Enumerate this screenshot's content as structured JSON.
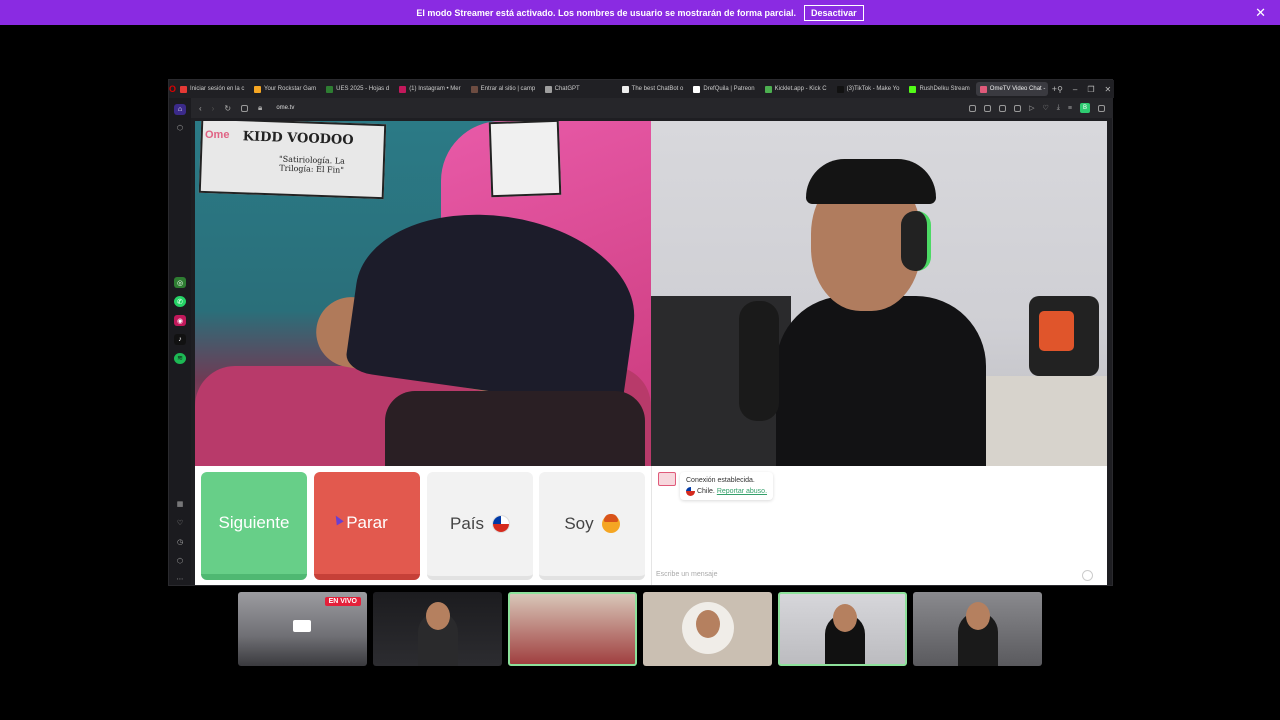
{
  "banner": {
    "message": "El modo Streamer está activado. Los nombres de usuario se mostrarán de forma parcial.",
    "button_label": "Desactivar",
    "close": "✕"
  },
  "browser": {
    "logo": "O",
    "tabs": [
      {
        "label": "Iniciar sesión en la c",
        "color": "#e53935"
      },
      {
        "label": "Your Rockstar Gam",
        "color": "#f5a623"
      },
      {
        "label": "UES 2025 - Hojas d",
        "color": "#2e7d32"
      },
      {
        "label": "(1) Instagram • Mer",
        "color": "#c2185b"
      },
      {
        "label": "Entrar al sitio | camp",
        "color": "#6d4c41"
      },
      {
        "label": "ChatGPT",
        "color": "#9e9e9e"
      },
      {
        "label": "The best ChatBot o",
        "color": "#eeeeee"
      },
      {
        "label": "DrefQuila | Patreon",
        "color": "#ffffff"
      },
      {
        "label": "Kicklet.app - Kick C",
        "color": "#4caf50"
      },
      {
        "label": "(3)TikTok - Make Yo",
        "color": "#111111"
      },
      {
        "label": "RushDelku Stream",
        "color": "#53fc18"
      },
      {
        "label": "OmeTV Video Chat -",
        "color": "#e05a7a"
      }
    ],
    "active_tab_index": 11,
    "url": "ome.tv",
    "window_controls": [
      "⚲",
      "–",
      "❐",
      "✕"
    ]
  },
  "page": {
    "watermark": "Ome",
    "poster_title": "KIDD VOODOO",
    "poster_subtitle": "\"Satiriología. La Trilogía: El Fin\"",
    "controls": {
      "next_label": "Siguiente",
      "stop_label": "Parar",
      "country_label": "País",
      "me_label": "Soy"
    },
    "chat": {
      "status_line": "Conexión establecida.",
      "country": "Chile.",
      "report_link": "Reportar abuso.",
      "input_placeholder": "Escribe un mensaje"
    }
  },
  "thumbnails": {
    "live_badge": "EN VIVO"
  },
  "colors": {
    "banner": "#8a2be2",
    "next": "#67cf88",
    "stop": "#e2594e",
    "link": "#35a06b",
    "selected_border": "#8de19b"
  }
}
